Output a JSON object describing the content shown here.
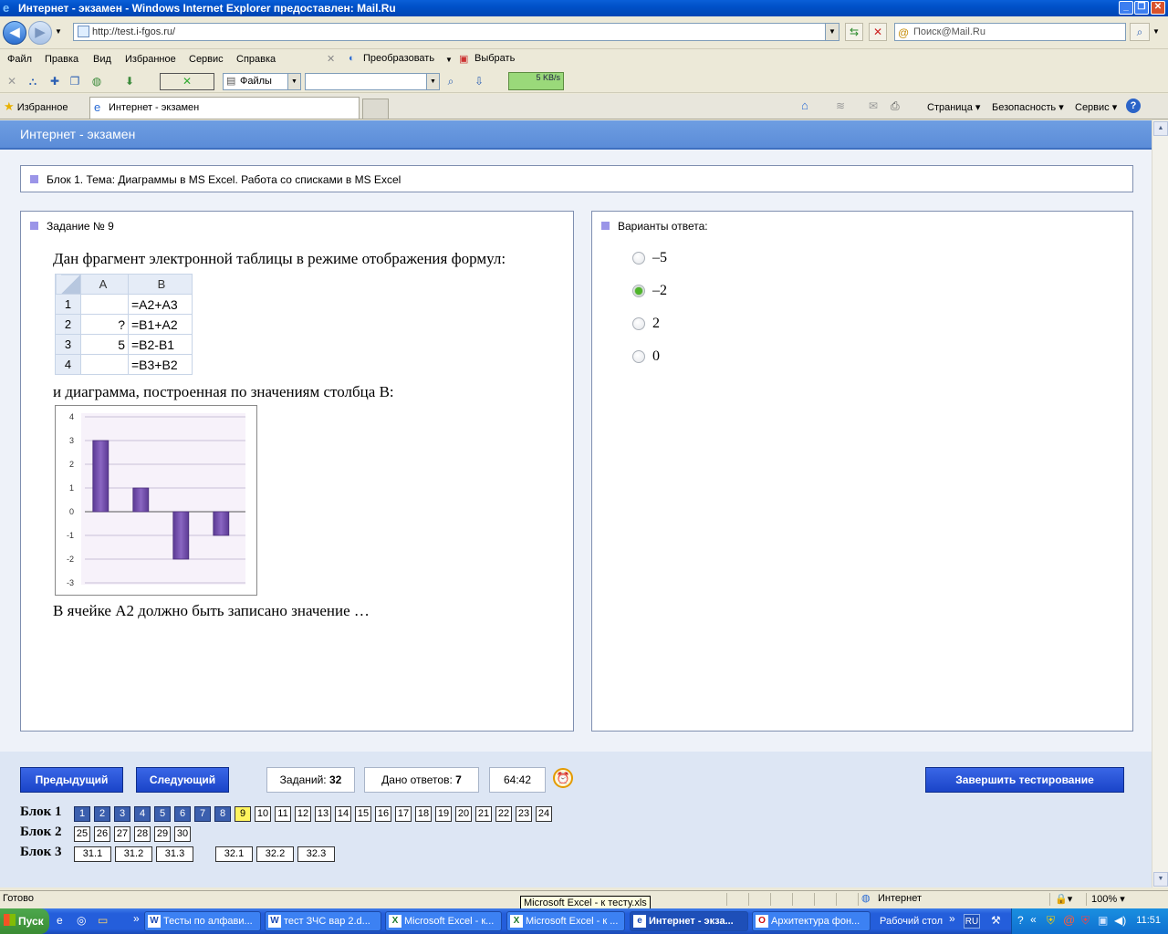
{
  "window": {
    "title": "Интернет - экзамен - Windows Internet Explorer предоставлен: Mail.Ru"
  },
  "address": {
    "url": "http://test.i-fgos.ru/",
    "search_placeholder": "Поиск@Mail.Ru"
  },
  "menu": {
    "items": [
      "Файл",
      "Правка",
      "Вид",
      "Избранное",
      "Сервис",
      "Справка"
    ],
    "convert": "Преобразовать",
    "select": "Выбрать"
  },
  "toolbar": {
    "files": "Файлы",
    "speed": "5 KB/s"
  },
  "tabs": {
    "favorites": "Избранное",
    "current": "Интернет - экзамен",
    "commands": {
      "page": "Страница",
      "safety": "Безопасность",
      "tools": "Сервис"
    }
  },
  "page": {
    "header": "Интернет - экзамен",
    "block_title": "Блок 1. Тема: Диаграммы в MS Excel. Работа со списками в MS Excel",
    "task": {
      "label": "Задание № 9",
      "intro": "Дан фрагмент электронной таблицы в режиме отображения формул:",
      "chart_caption": "и диаграмма, построенная по значениям столбца B:",
      "question": "В ячейке A2 должно быть записано значение …",
      "sheet": {
        "corner": "",
        "col_a": "A",
        "col_b": "B",
        "rows": [
          {
            "n": "1",
            "a": "",
            "b": "=A2+A3"
          },
          {
            "n": "2",
            "a": "?",
            "b": "=B1+A2"
          },
          {
            "n": "3",
            "a": "5",
            "b": "=B2-B1"
          },
          {
            "n": "4",
            "a": "",
            "b": "=B3+B2"
          }
        ]
      }
    },
    "answers": {
      "label": "Варианты ответа:",
      "options": [
        {
          "text": "–5",
          "checked": false
        },
        {
          "text": "–2",
          "checked": true
        },
        {
          "text": "2",
          "checked": false
        },
        {
          "text": "0",
          "checked": false
        }
      ]
    },
    "nav": {
      "prev": "Предыдущий",
      "next": "Следующий",
      "tasks_label": "Заданий:",
      "tasks_count": "32",
      "answered_label": "Дано ответов:",
      "answered_count": "7",
      "timer": "64:42",
      "finish": "Завершить тестирование"
    },
    "blocks": [
      {
        "label": "Блок 1",
        "items": [
          "1",
          "2",
          "3",
          "4",
          "5",
          "6",
          "7",
          "8",
          "9",
          "10",
          "11",
          "12",
          "13",
          "14",
          "15",
          "16",
          "17",
          "18",
          "19",
          "20",
          "21",
          "22",
          "23",
          "24"
        ]
      },
      {
        "label": "Блок 2",
        "items": [
          "25",
          "26",
          "27",
          "28",
          "29",
          "30"
        ]
      },
      {
        "label": "Блок 3",
        "items": [
          "31.1",
          "31.2",
          "31.3",
          "32.1",
          "32.2",
          "32.3"
        ]
      }
    ],
    "answered_items": [
      "1",
      "2",
      "3",
      "4",
      "5",
      "6",
      "7",
      "8"
    ],
    "current_item": "9"
  },
  "chart_data": {
    "type": "bar",
    "categories": [
      "",
      "",
      "",
      ""
    ],
    "values": [
      3,
      1,
      -2,
      -1
    ],
    "ylim": [
      -3,
      4
    ],
    "yticks": [
      "4",
      "3",
      "2",
      "1",
      "0",
      "-1",
      "-2",
      "-3"
    ],
    "grid": true,
    "bar_color": "#7b55b0"
  },
  "status": {
    "left": "Готово",
    "zone": "Интернет",
    "zoom": "100%",
    "tooltip": "Microsoft Excel - к тесту.xls"
  },
  "taskbar": {
    "start": "Пуск",
    "items": [
      "Тесты по алфави...",
      "тест ЗЧС вар 2.d...",
      "Microsoft Excel - к...",
      "Microsoft Excel - к ...",
      "Интернет - экза...",
      "Архитектура фон..."
    ],
    "desktop": "Рабочий стол",
    "lang": "RU",
    "time": "11:51"
  }
}
